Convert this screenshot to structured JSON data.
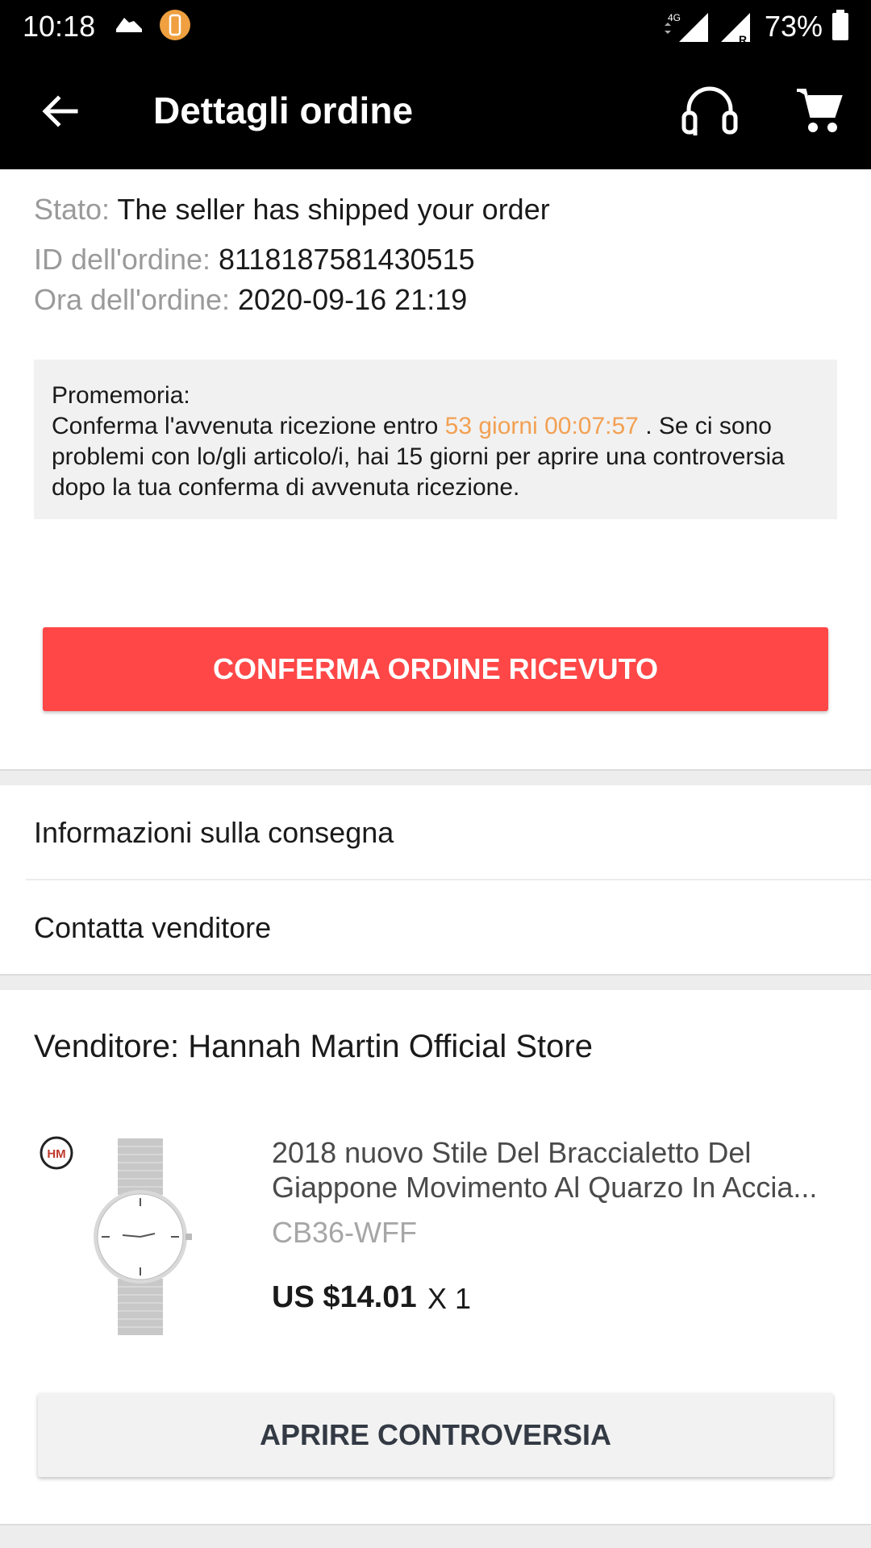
{
  "status_bar": {
    "time": "10:18",
    "network": "4G",
    "roaming": "R",
    "battery": "73%"
  },
  "app_bar": {
    "title": "Dettagli ordine",
    "icons": [
      "back-arrow-icon",
      "headset-icon",
      "cart-icon"
    ]
  },
  "order": {
    "status_label": "Stato:",
    "status_value": "The seller has shipped your order",
    "id_label": "ID dell'ordine:",
    "id_value": "8118187581430515",
    "time_label": "Ora dell'ordine:",
    "time_value": "2020-09-16 21:19"
  },
  "reminder": {
    "title": "Promemoria:",
    "text_before": "Conferma l'avvenuta ricezione entro ",
    "countdown": "53 giorni 00:07:57",
    "text_after": " . Se ci sono problemi con lo/gli articolo/i, hai 15 giorni per aprire una controversia dopo la tua conferma di avvenuta ricezione."
  },
  "confirm_button": "CONFERMA ORDINE RICEVUTO",
  "links": {
    "delivery_info": "Informazioni sulla consegna",
    "contact_seller": "Contatta venditore"
  },
  "seller": "Venditore: Hannah Martin Official Store",
  "product": {
    "title": "2018 nuovo Stile Del Braccialetto Del Giappone Movimento Al Quarzo In Accia...",
    "sku": "CB36-WFF",
    "price": "US $14.01",
    "quantity": "X 1",
    "brand_logo": "HM"
  },
  "dispute_button": "APRIRE CONTROVERSIA",
  "colors": {
    "accent_red": "#ff4747",
    "countdown_orange": "#f3a052",
    "bar_black": "#000000"
  }
}
